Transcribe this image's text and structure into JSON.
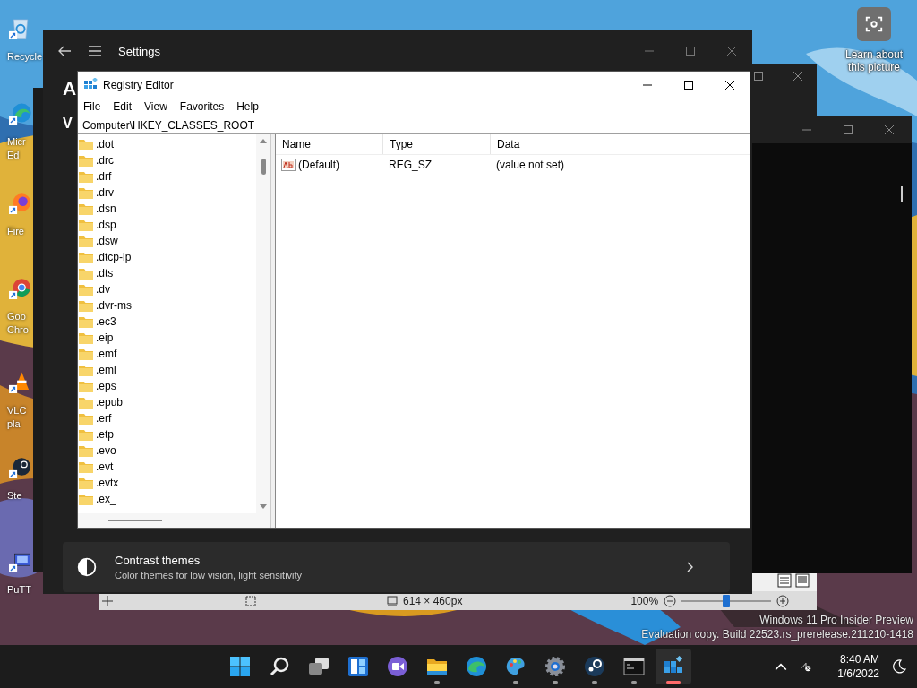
{
  "desktop_icons": [
    {
      "kind": "recycle",
      "lines": [
        "Recycle"
      ]
    },
    {
      "kind": "edge",
      "lines": [
        "Micr",
        "Ed"
      ]
    },
    {
      "kind": "firefox",
      "lines": [
        "Fire"
      ]
    },
    {
      "kind": "chrome",
      "lines": [
        "Goo",
        "Chro"
      ]
    },
    {
      "kind": "vlc",
      "lines": [
        "VLC",
        "pla"
      ]
    },
    {
      "kind": "steam",
      "lines": [
        "Ste"
      ]
    },
    {
      "kind": "putty",
      "lines": [
        "PuTT"
      ]
    }
  ],
  "spotlight": {
    "label": "Learn about this picture"
  },
  "settings": {
    "title": "Settings",
    "heading": "A",
    "section": "V",
    "card": {
      "title": "Contrast themes",
      "subtitle": "Color themes for low vision, light sensitivity"
    }
  },
  "paint": {
    "size": "614 × 460px",
    "zoom": "100%",
    "level": 0.5
  },
  "registry": {
    "title": "Registry Editor",
    "menu": [
      "File",
      "Edit",
      "View",
      "Favorites",
      "Help"
    ],
    "address": "Computer\\HKEY_CLASSES_ROOT",
    "tree": [
      {
        "label": ".dot"
      },
      {
        "label": ".drc"
      },
      {
        "label": ".drf"
      },
      {
        "label": ".drv"
      },
      {
        "label": ".dsn"
      },
      {
        "label": ".dsp"
      },
      {
        "label": ".dsw"
      },
      {
        "label": ".dtcp-ip"
      },
      {
        "label": ".dts"
      },
      {
        "label": ".dv"
      },
      {
        "label": ".dvr-ms"
      },
      {
        "label": ".ec3"
      },
      {
        "label": ".eip"
      },
      {
        "label": ".emf"
      },
      {
        "label": ".eml"
      },
      {
        "label": ".eps"
      },
      {
        "label": ".epub"
      },
      {
        "label": ".erf"
      },
      {
        "label": ".etp"
      },
      {
        "label": ".evo"
      },
      {
        "label": ".evt"
      },
      {
        "label": ".evtx"
      },
      {
        "label": ".ex_"
      }
    ],
    "columns": [
      "Name",
      "Type",
      "Data"
    ],
    "rows": [
      {
        "name": "(Default)",
        "type": "REG_SZ",
        "data": "(value not set)"
      }
    ]
  },
  "os_notice": [
    "Windows 11 Pro Insider Preview",
    "Evaluation copy. Build 22523.rs_prerelease.211210-1418"
  ],
  "taskbar": {
    "apps": [
      {
        "kind": "start",
        "running": false,
        "selected": false
      },
      {
        "kind": "search",
        "running": false,
        "selected": false
      },
      {
        "kind": "taskview",
        "running": false,
        "selected": false
      },
      {
        "kind": "widgets",
        "running": false,
        "selected": false
      },
      {
        "kind": "chat",
        "running": false,
        "selected": false
      },
      {
        "kind": "explorer",
        "running": true,
        "selected": false
      },
      {
        "kind": "edge",
        "running": false,
        "selected": false
      },
      {
        "kind": "paint",
        "running": true,
        "selected": false
      },
      {
        "kind": "settings",
        "running": true,
        "selected": false
      },
      {
        "kind": "steam",
        "running": true,
        "selected": false
      },
      {
        "kind": "terminal",
        "running": true,
        "selected": false
      },
      {
        "kind": "regedit",
        "running": true,
        "selected": true
      }
    ],
    "time": "8:40 AM",
    "date": "1/6/2022"
  }
}
